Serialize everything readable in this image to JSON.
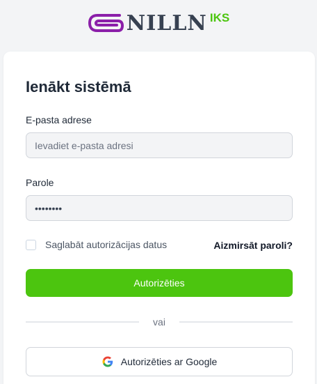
{
  "logo": {
    "wordmark": "NILLN",
    "superscript": "IKS",
    "brand_color": "#8b1fa9",
    "accent_color": "#4cc50f"
  },
  "form": {
    "title": "Ienākt sistēmā",
    "email_label": "E-pasta adrese",
    "email_placeholder": "Ievadiet e-pasta adresi",
    "password_label": "Parole",
    "password_value": "password",
    "remember_label": "Saglabāt autorizācijas datus",
    "remember_checked": false,
    "forgot_label": "Aizmirsāt paroli?",
    "submit_label": "Autorizēties",
    "divider_label": "vai",
    "google_label": "Autorizēties ar Google",
    "google_icon": "google-icon"
  }
}
